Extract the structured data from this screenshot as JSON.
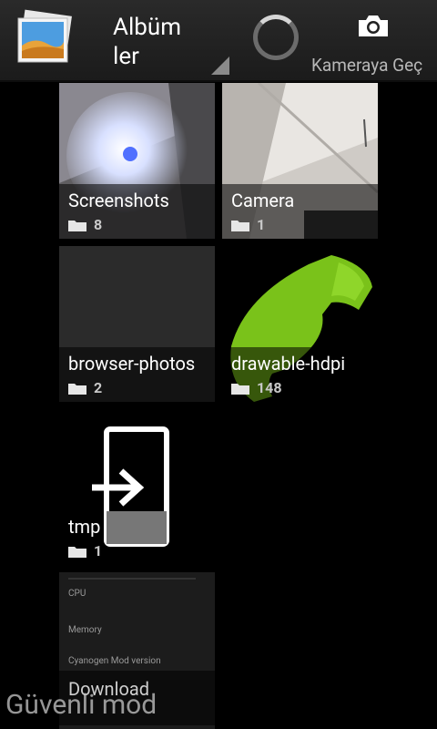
{
  "actionbar": {
    "title_line1": "Albüm",
    "title_line2": "ler",
    "camera_label": "Kameraya Geç"
  },
  "albums": [
    {
      "name": "Screenshots",
      "count": "8"
    },
    {
      "name": "Camera",
      "count": "1"
    },
    {
      "name": "browser-photos",
      "count": "2"
    },
    {
      "name": "drawable-hdpi",
      "count": "148"
    },
    {
      "name": "tmp",
      "count": "1"
    },
    {
      "name": "Download",
      "count": ""
    }
  ],
  "download_thumb_text": [
    "CPU",
    "Memory",
    "Cyanogen Mod version"
  ],
  "overlay_text": "Güvenli mod",
  "colors": {
    "accent_green": "#7ac21a",
    "actionbar": "#222222"
  }
}
